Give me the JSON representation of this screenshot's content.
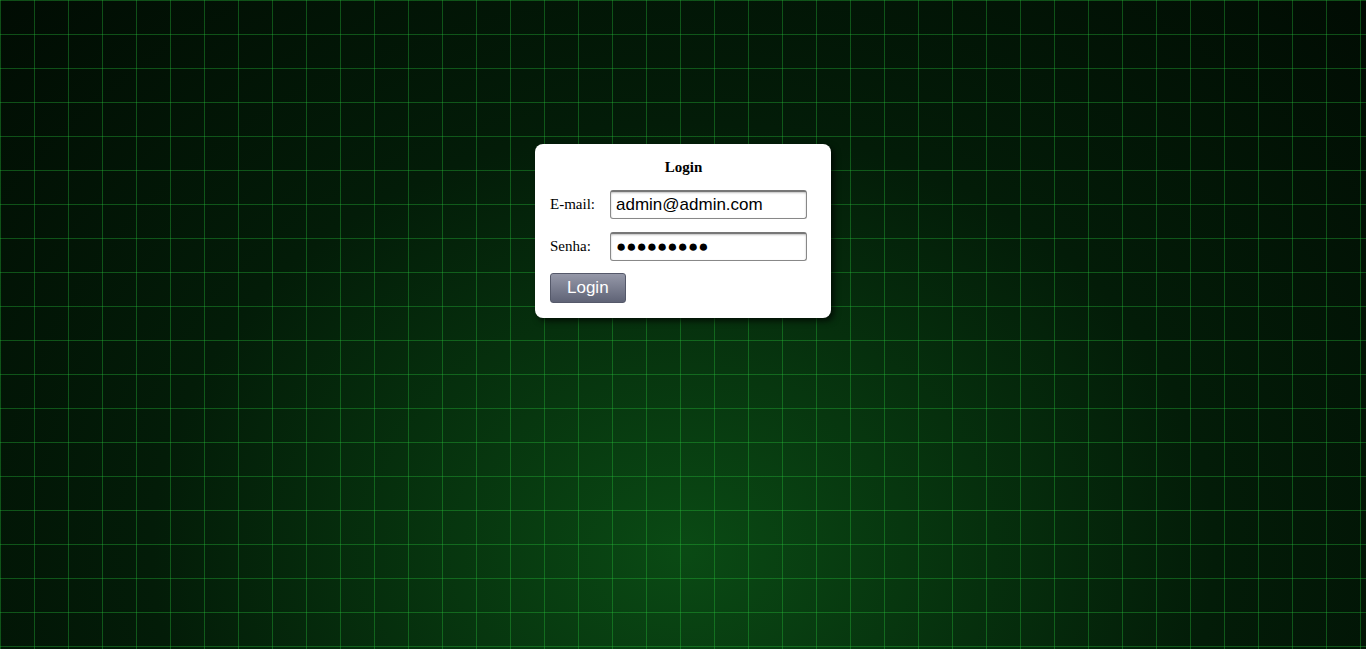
{
  "form": {
    "title": "Login",
    "fields": [
      {
        "label": "E-mail:",
        "value": "admin@admin.com"
      },
      {
        "label": "Senha:",
        "value": "●●●●●●●●●"
      }
    ],
    "button": "Login"
  }
}
